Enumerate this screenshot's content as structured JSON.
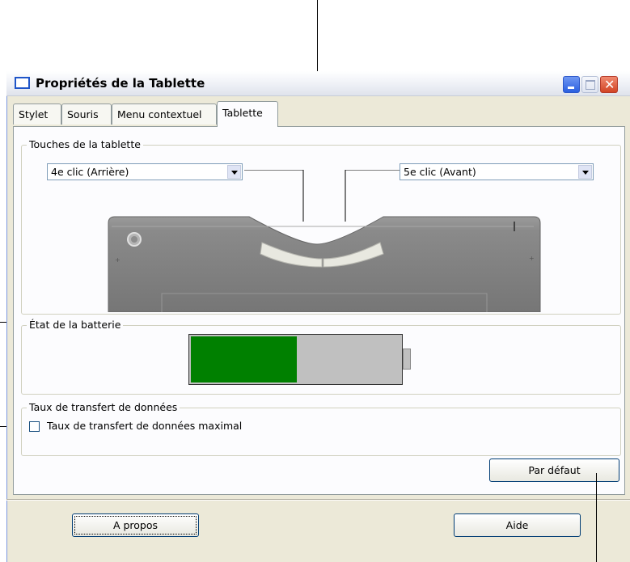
{
  "window": {
    "title": "Propriétés de la Tablette"
  },
  "tabs": [
    {
      "label": "Stylet"
    },
    {
      "label": "Souris"
    },
    {
      "label": "Menu contextuel"
    },
    {
      "label": "Tablette",
      "active": true
    }
  ],
  "tablet_keys": {
    "legend": "Touches de la tablette",
    "left_button_value": "4e clic (Arrière)",
    "right_button_value": "5e clic (Avant)"
  },
  "battery": {
    "legend": "État de la batterie",
    "level": 0.5,
    "fill_color": "#008000",
    "empty_color": "#c0c0c0"
  },
  "transfer_rate": {
    "legend": "Taux de transfert de données",
    "checkbox_label": "Taux de transfert de données maximal",
    "checked": false
  },
  "buttons": {
    "default": "Par défaut",
    "about": "A propos",
    "help": "Aide"
  },
  "icons": {
    "title": "window-icon",
    "minimize": "minimize-icon",
    "maximize": "maximize-icon",
    "close": "close-icon"
  }
}
